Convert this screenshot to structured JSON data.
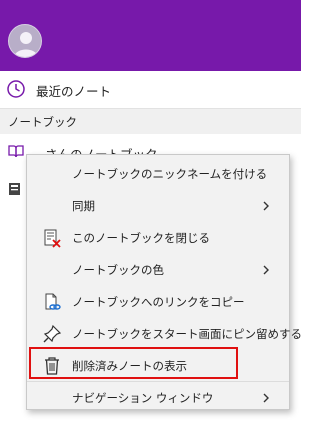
{
  "nav": {
    "recent_label": "最近のノート",
    "section_label": "ノートブック",
    "notebook1_label": "さんのノートブック"
  },
  "context_menu": {
    "items": [
      {
        "label": "ノートブックのニックネームを付ける",
        "icon": "none",
        "submenu": false
      },
      {
        "label": "同期",
        "icon": "none",
        "submenu": true
      },
      {
        "label": "このノートブックを閉じる",
        "icon": "close-notebook-icon",
        "submenu": false
      },
      {
        "label": "ノートブックの色",
        "icon": "none",
        "submenu": true
      },
      {
        "label": "ノートブックへのリンクをコピー",
        "icon": "copy-link-icon",
        "submenu": false
      },
      {
        "label": "ノートブックをスタート画面にピン留めする",
        "icon": "pin-icon",
        "submenu": false
      },
      {
        "label": "削除済みノートの表示",
        "icon": "trash-icon",
        "submenu": false,
        "highlighted": true
      },
      {
        "label": "ナビゲーション ウィンドウ",
        "icon": "none",
        "submenu": true
      }
    ]
  },
  "colors": {
    "header": "#7719aa",
    "accent": "#7719aa",
    "highlight_border": "#e01010"
  }
}
